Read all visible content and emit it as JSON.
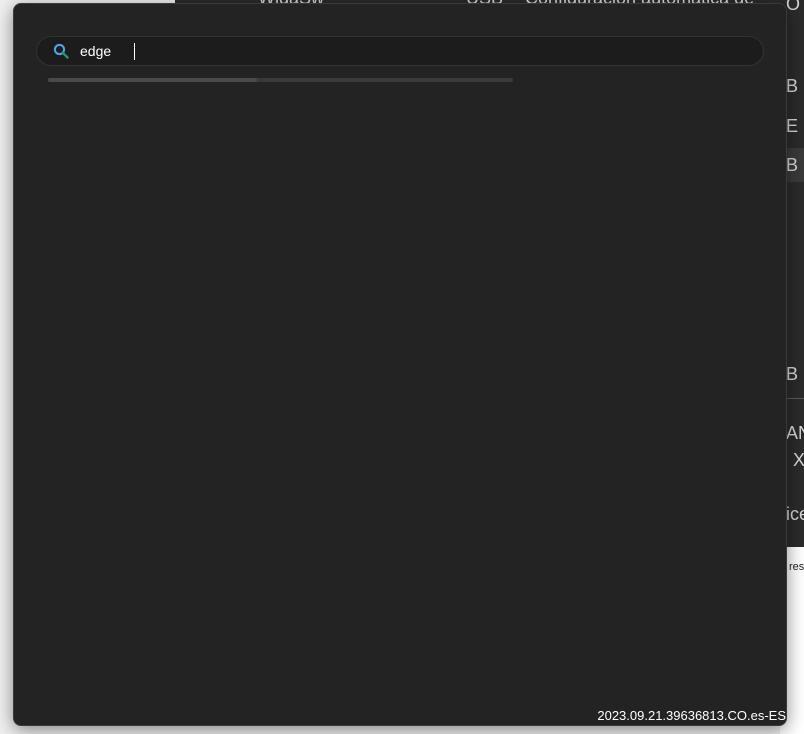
{
  "background_window": {
    "fragments": [
      "WidaSw",
      "USB",
      "Configuración automática de",
      "O",
      "B",
      "E",
      "B",
      "B",
      "AN",
      "X",
      "ice",
      "res"
    ]
  },
  "search": {
    "value": "edge",
    "icon": "search-icon",
    "progress": 0.45
  },
  "footer": {
    "version": "2023.09.21.39636813.CO.es-ES"
  },
  "colors": {
    "panel": "#232323",
    "input_bg": "#1c1c1c",
    "icon_primary": "#4aa8e8",
    "icon_secondary": "#2f8f6f"
  }
}
